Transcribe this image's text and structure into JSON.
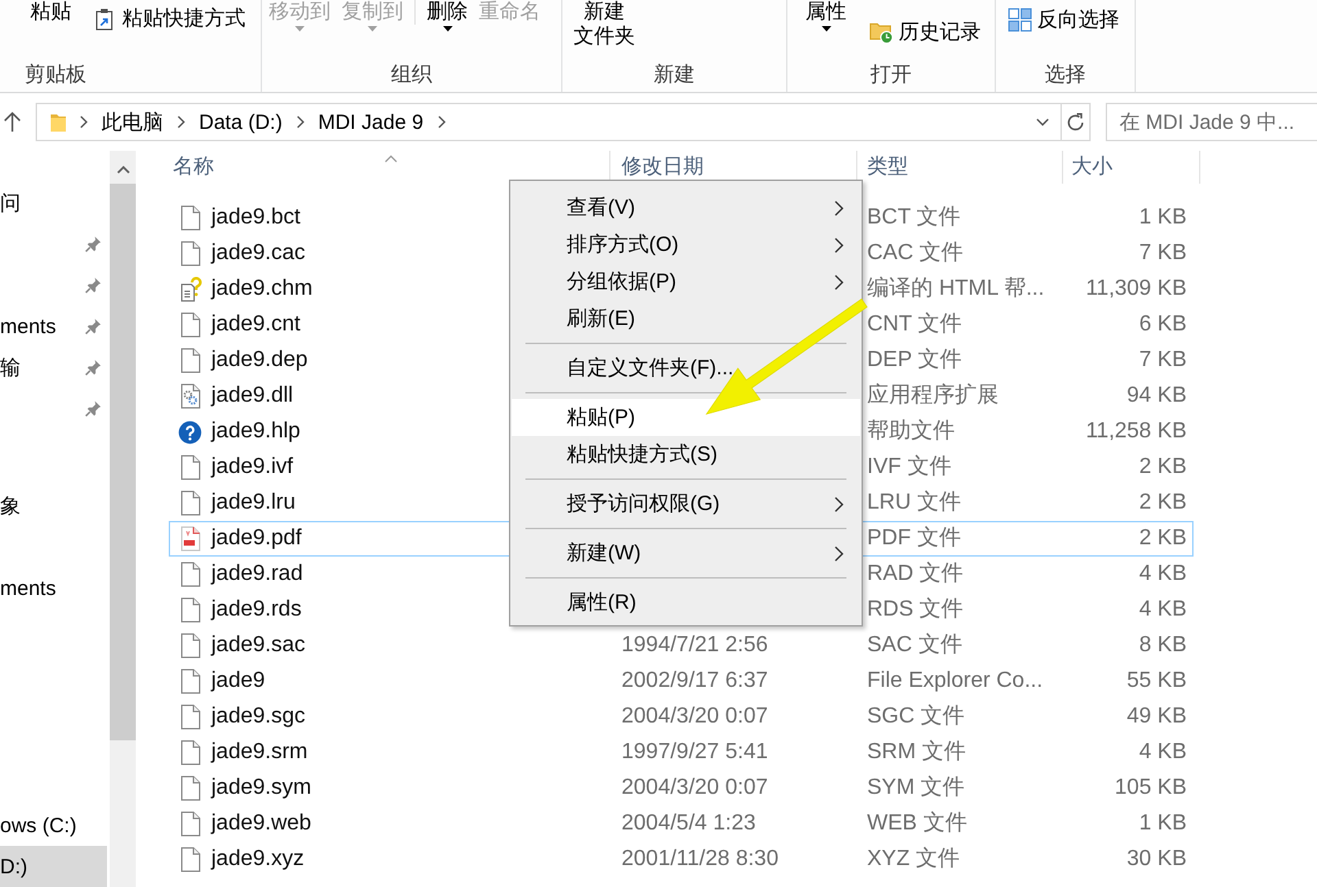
{
  "ribbon": {
    "groups": [
      {
        "label": "剪贴板",
        "sets": [
          {
            "commands": [
              {
                "kind": "large",
                "label": "粘贴",
                "disabled": false,
                "dropdown": false
              },
              {
                "kind": "shortcut",
                "label": "粘贴快捷方式",
                "disabled": false,
                "dropdown": false
              }
            ]
          }
        ]
      },
      {
        "label": "组织",
        "sets": [
          {
            "commands": [
              {
                "kind": "large",
                "label": "移动到",
                "disabled": true,
                "dropdown": true
              },
              {
                "kind": "large",
                "label": "复制到",
                "disabled": true,
                "dropdown": true
              }
            ]
          },
          {
            "commands": [
              {
                "kind": "large",
                "label": "删除",
                "disabled": false,
                "dropdown": true
              },
              {
                "kind": "large",
                "label": "重命名",
                "disabled": true,
                "dropdown": false
              }
            ]
          }
        ]
      },
      {
        "label": "新建",
        "sets": [
          {
            "commands": [
              {
                "kind": "large",
                "lines": [
                  "新建",
                  "文件夹"
                ],
                "disabled": false,
                "dropdown": false
              }
            ]
          }
        ]
      },
      {
        "label": "打开",
        "sets": [
          {
            "commands": [
              {
                "kind": "large",
                "label": "属性",
                "disabled": false,
                "dropdown": true
              },
              {
                "kind": "history",
                "label": "历史记录",
                "disabled": false,
                "dropdown": false
              }
            ]
          }
        ]
      },
      {
        "label": "选择",
        "sets": [
          {
            "commands": [
              {
                "kind": "invert",
                "label": "反向选择",
                "disabled": false,
                "dropdown": false
              }
            ]
          }
        ]
      }
    ]
  },
  "address_bar": {
    "breadcrumbs": [
      "此电脑",
      "Data (D:)",
      "MDI Jade 9"
    ]
  },
  "search": {
    "placeholder": "在 MDI Jade 9 中..."
  },
  "nav": {
    "sections": [
      {
        "items": [
          {
            "label": "问",
            "pinned": false,
            "selected": false
          },
          {
            "pinned": true,
            "selected": false
          },
          {
            "pinned": true,
            "selected": false
          },
          {
            "label": "ments",
            "pinned": true,
            "selected": false
          },
          {
            "label": "输",
            "pinned": true,
            "selected": false
          },
          {
            "pinned": true,
            "selected": false
          }
        ]
      },
      {
        "items": [
          {
            "label": "象",
            "pinned": false,
            "selected": false
          }
        ]
      },
      {
        "items": [
          {
            "label": "ments",
            "pinned": false,
            "selected": false
          }
        ]
      },
      {
        "items": [
          {
            "label": "ows (C:)",
            "pinned": false,
            "selected": false
          },
          {
            "label": "D:)",
            "pinned": false,
            "selected": true
          }
        ]
      }
    ]
  },
  "table": {
    "columns": [
      {
        "label": "名称",
        "sorted": true
      },
      {
        "label": "修改日期",
        "sorted": false
      },
      {
        "label": "类型",
        "sorted": false
      },
      {
        "label": "大小",
        "sorted": false
      }
    ],
    "rows": [
      {
        "kind": "plain",
        "name": "jade9.bct",
        "type": "BCT 文件",
        "size": "1 KB",
        "focused": false
      },
      {
        "kind": "plain",
        "name": "jade9.cac",
        "type": "CAC 文件",
        "size": "7 KB",
        "focused": false
      },
      {
        "kind": "chm",
        "name": "jade9.chm",
        "type": "编译的 HTML 帮...",
        "size": "11,309 KB",
        "focused": false
      },
      {
        "kind": "plain",
        "name": "jade9.cnt",
        "type": "CNT 文件",
        "size": "6 KB",
        "focused": false
      },
      {
        "kind": "plain",
        "name": "jade9.dep",
        "type": "DEP 文件",
        "size": "7 KB",
        "focused": false
      },
      {
        "kind": "dll",
        "name": "jade9.dll",
        "type": "应用程序扩展",
        "size": "94 KB",
        "focused": false
      },
      {
        "kind": "hlp",
        "name": "jade9.hlp",
        "type": "帮助文件",
        "size": "11,258 KB",
        "focused": false
      },
      {
        "kind": "plain",
        "name": "jade9.ivf",
        "type": "IVF 文件",
        "size": "2 KB",
        "focused": false
      },
      {
        "kind": "plain",
        "name": "jade9.lru",
        "type": "LRU 文件",
        "size": "2 KB",
        "focused": false
      },
      {
        "kind": "pdf",
        "name": "jade9.pdf",
        "type": "PDF 文件",
        "size": "2 KB",
        "focused": true
      },
      {
        "kind": "plain",
        "name": "jade9.rad",
        "type": "RAD 文件",
        "size": "4 KB",
        "focused": false
      },
      {
        "kind": "plain",
        "name": "jade9.rds",
        "type": "RDS 文件",
        "size": "4 KB",
        "focused": false
      },
      {
        "kind": "plain",
        "name": "jade9.sac",
        "modified": "1994/7/21 2:56",
        "type": "SAC 文件",
        "size": "8 KB",
        "focused": false
      },
      {
        "kind": "plain",
        "name": "jade9",
        "modified": "2002/9/17 6:37",
        "type": "File Explorer Co...",
        "size": "55 KB",
        "focused": false
      },
      {
        "kind": "plain",
        "name": "jade9.sgc",
        "modified": "2004/3/20 0:07",
        "type": "SGC 文件",
        "size": "49 KB",
        "focused": false
      },
      {
        "kind": "plain",
        "name": "jade9.srm",
        "modified": "1997/9/27 5:41",
        "type": "SRM 文件",
        "size": "4 KB",
        "focused": false
      },
      {
        "kind": "plain",
        "name": "jade9.sym",
        "modified": "2004/3/20 0:07",
        "type": "SYM 文件",
        "size": "105 KB",
        "focused": false
      },
      {
        "kind": "plain",
        "name": "jade9.web",
        "modified": "2004/5/4 1:23",
        "type": "WEB 文件",
        "size": "1 KB",
        "focused": false
      },
      {
        "kind": "plain",
        "name": "jade9.xyz",
        "modified": "2001/11/28 8:30",
        "type": "XYZ 文件",
        "size": "30 KB",
        "focused": false
      }
    ]
  },
  "context_menu": {
    "groups": [
      {
        "items": [
          {
            "label": "查看(V)",
            "submenu": true,
            "highlighted": false
          },
          {
            "label": "排序方式(O)",
            "submenu": true,
            "highlighted": false
          },
          {
            "label": "分组依据(P)",
            "submenu": true,
            "highlighted": false
          },
          {
            "label": "刷新(E)",
            "submenu": false,
            "highlighted": false
          }
        ]
      },
      {
        "items": [
          {
            "label": "自定义文件夹(F)...",
            "submenu": false,
            "highlighted": false
          }
        ]
      },
      {
        "items": [
          {
            "label": "粘贴(P)",
            "submenu": false,
            "highlighted": true
          },
          {
            "label": "粘贴快捷方式(S)",
            "submenu": false,
            "highlighted": false
          }
        ]
      },
      {
        "items": [
          {
            "label": "授予访问权限(G)",
            "submenu": true,
            "highlighted": false
          }
        ]
      },
      {
        "items": [
          {
            "label": "新建(W)",
            "submenu": true,
            "highlighted": false
          }
        ]
      },
      {
        "items": [
          {
            "label": "属性(R)",
            "submenu": false,
            "highlighted": false
          }
        ]
      }
    ]
  },
  "callout": {
    "kind": "arrow"
  }
}
